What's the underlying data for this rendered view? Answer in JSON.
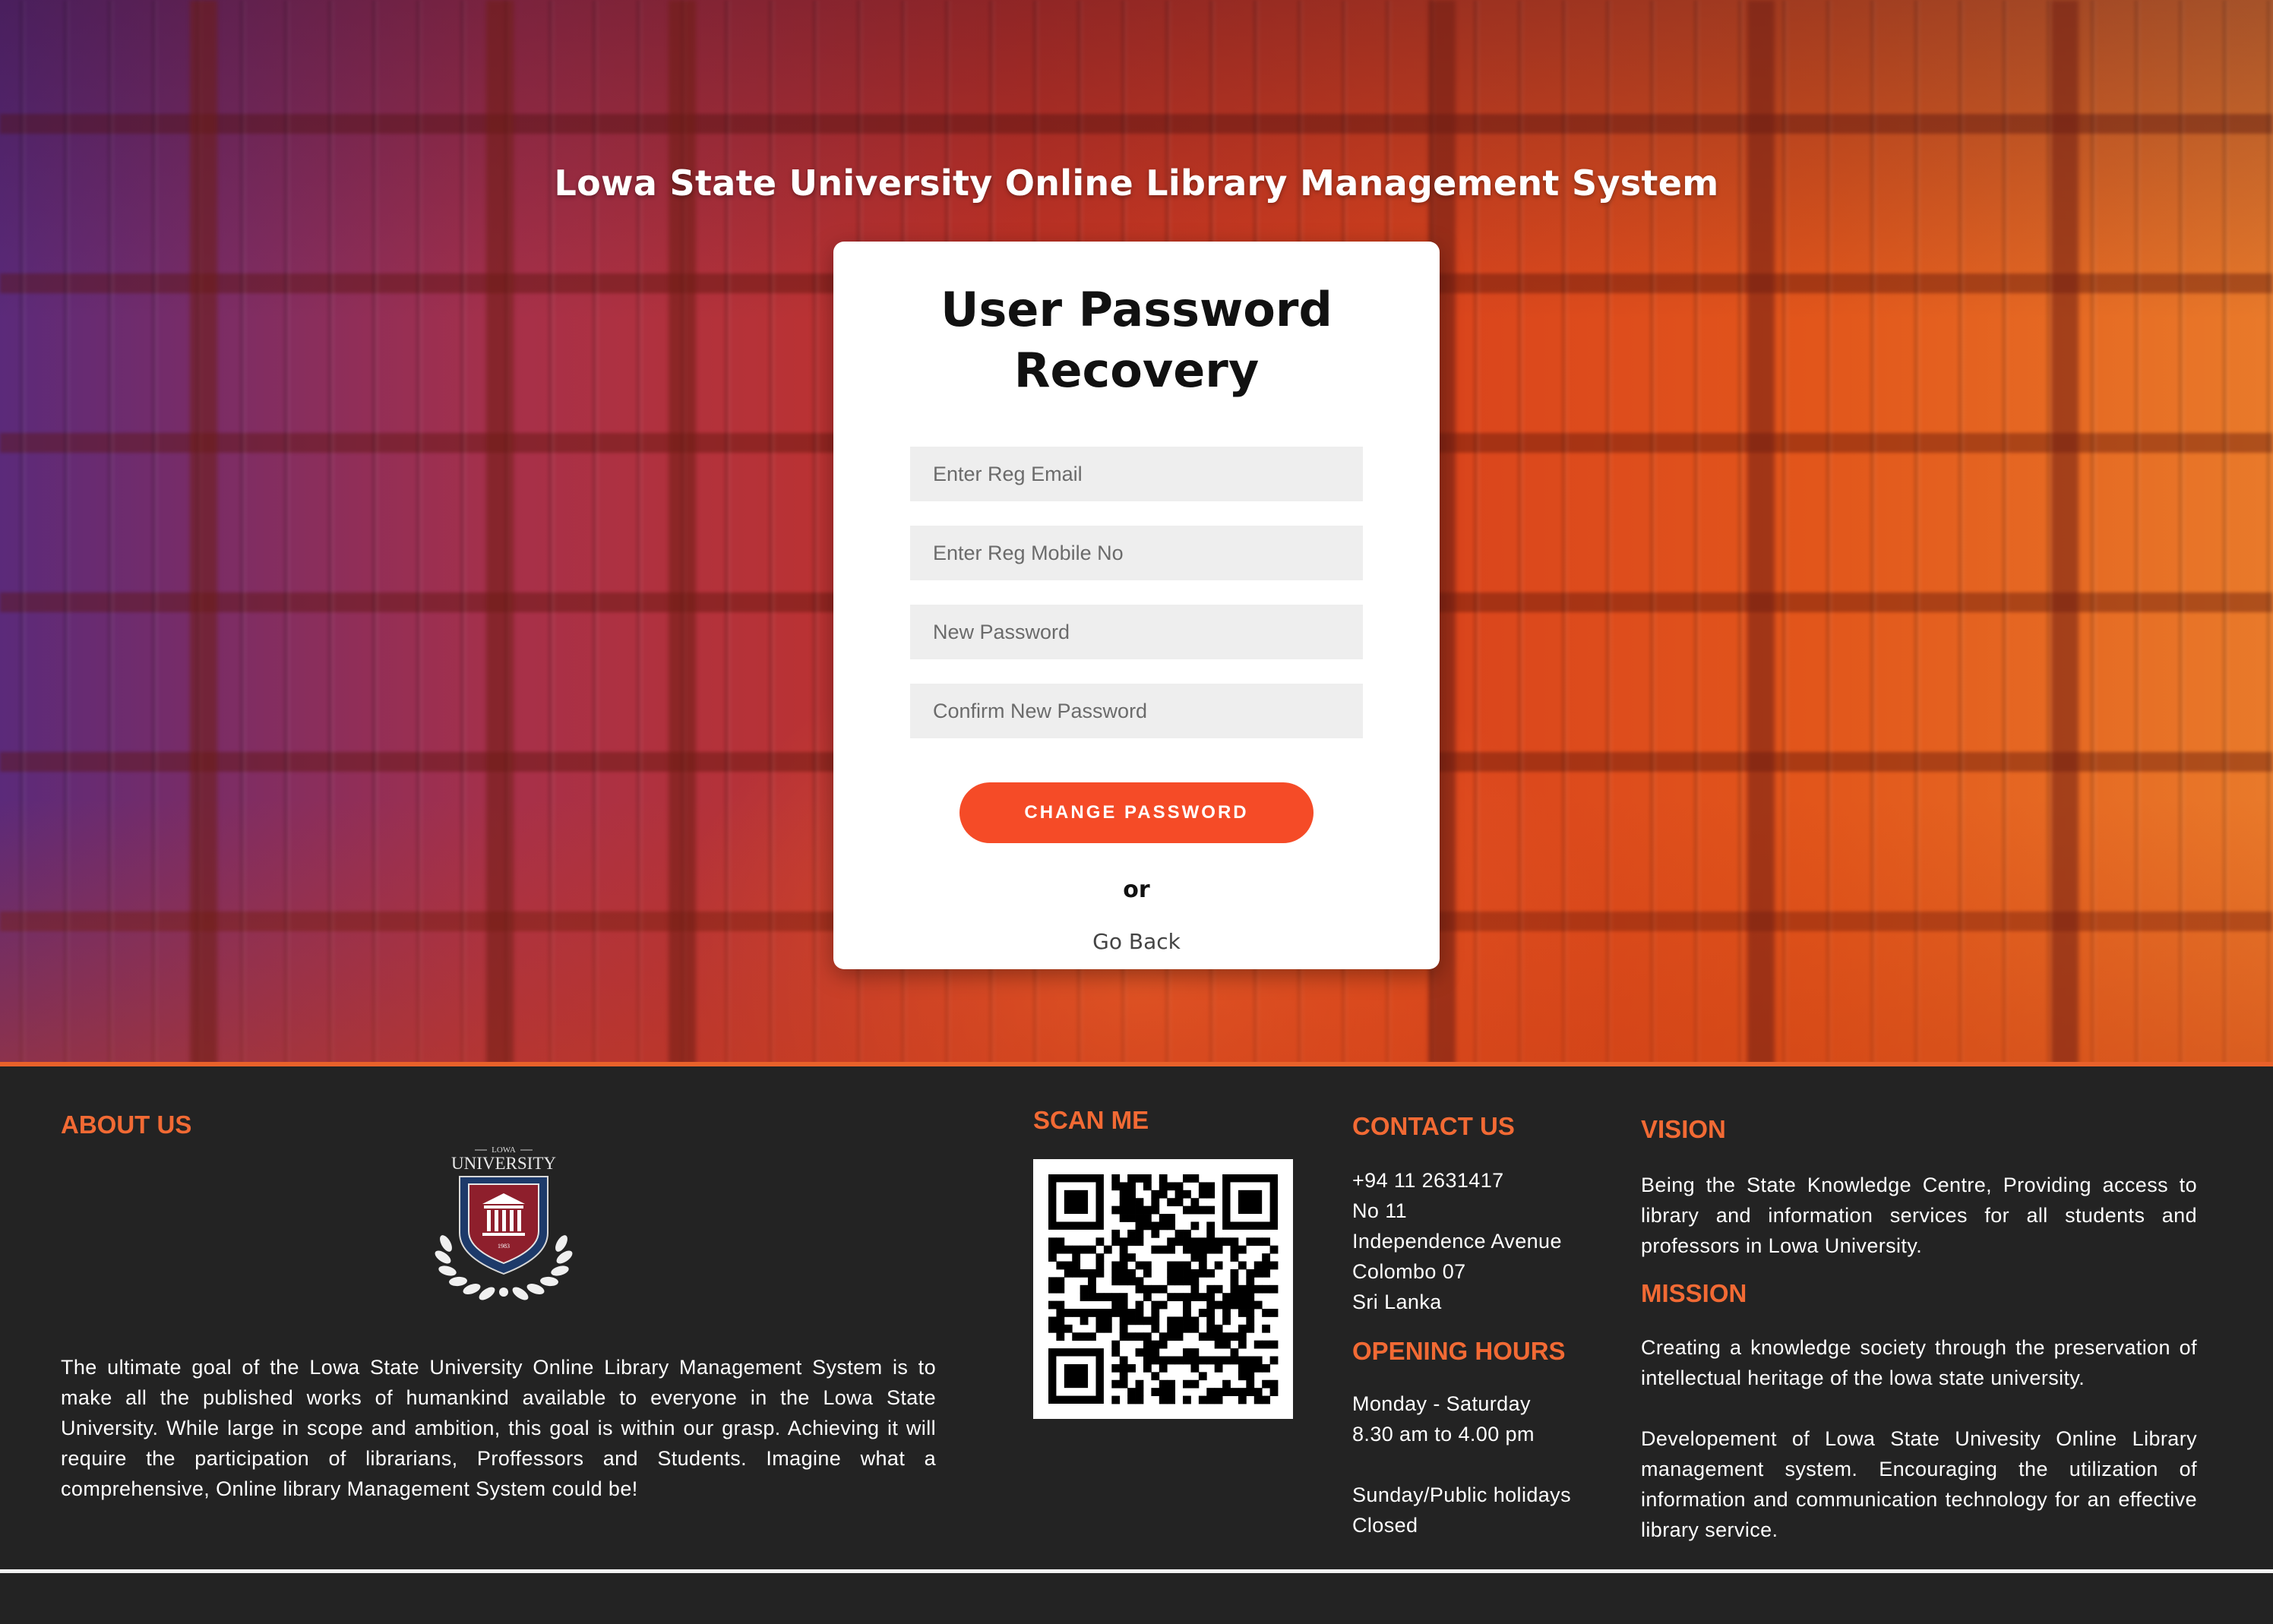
{
  "header": {
    "site_title": "Lowa State University Online Library Management System"
  },
  "recovery_card": {
    "title": "User Password Recovery",
    "email_placeholder": "Enter Reg Email",
    "mobile_placeholder": "Enter Reg Mobile No",
    "new_password_placeholder": "New Password",
    "confirm_password_placeholder": "Confirm New Password",
    "submit_label": "CHANGE PASSWORD",
    "or_text": "or",
    "go_back_label": "Go Back"
  },
  "footer": {
    "about": {
      "heading": "ABOUT US",
      "logo_top_text": "LOWA",
      "logo_name": "UNIVERSITY",
      "logo_year": "1983",
      "text": "The ultimate goal of the Lowa State University Online Library Management System is to make all the published works of humankind available to everyone in the Lowa State University. While large in scope and ambition, this goal is within our grasp. Achieving it will require the participation of librarians, Proffessors and Students. Imagine what a comprehensive, Online library Management System could be!"
    },
    "scan": {
      "heading": "SCAN ME"
    },
    "contact": {
      "heading": "CONTACT US",
      "phone": "+94 11 2631417",
      "address_line1": "No 11",
      "address_line2": "Independence Avenue",
      "address_line3": "Colombo 07",
      "address_line4": "Sri Lanka"
    },
    "hours": {
      "heading": "OPENING HOURS",
      "weekdays": "Monday - Saturday",
      "weekday_hours": "8.30 am to 4.00 pm",
      "holidays": "Sunday/Public holidays",
      "holiday_status": "Closed"
    },
    "vision": {
      "heading": "VISION",
      "text": "Being the State Knowledge Centre, Providing access to library and information services for all students and professors in Lowa University."
    },
    "mission": {
      "heading": "MISSION",
      "text1": "Creating a knowledge society through the preservation of intellectual heritage of the lowa state university.",
      "text2": "Developement of Lowa State Univesity Online Library management system. Encouraging the utilization of information and communication technology for an effective library service."
    }
  },
  "colors": {
    "accent": "#f54b27",
    "footer_heading": "#f26a34",
    "footer_bg": "#232323"
  }
}
